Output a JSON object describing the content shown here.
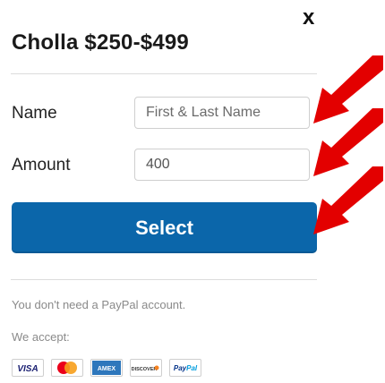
{
  "close_label": "x",
  "title": "Cholla $250-$499",
  "form": {
    "name_label": "Name",
    "name_placeholder": "First & Last Name",
    "amount_label": "Amount",
    "amount_value": "400",
    "currency_symbol": "$",
    "select_label": "Select"
  },
  "footer": {
    "paypal_note": "You don't need a PayPal account.",
    "accept_label": "We accept:",
    "cards": [
      "VISA",
      "Mastercard",
      "AMEX",
      "DISCOVER",
      "PayPal"
    ]
  },
  "colors": {
    "primary_button": "#0b66aa",
    "annotation_arrow": "#e30000"
  }
}
